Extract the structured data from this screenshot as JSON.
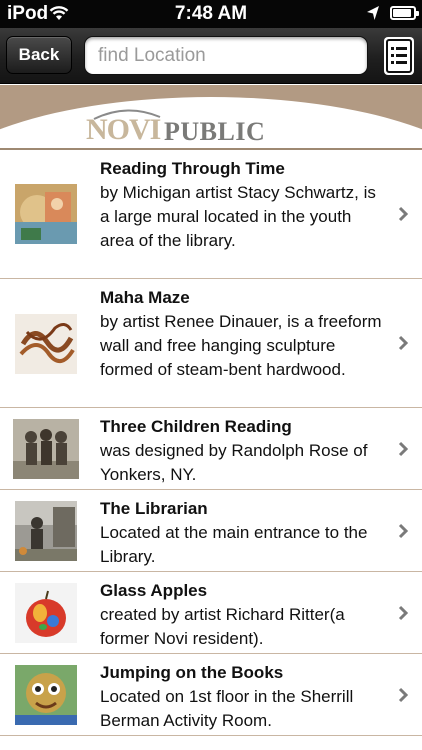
{
  "status_bar": {
    "carrier": "iPod",
    "time": "7:48 AM",
    "battery_level": 0.9
  },
  "navbar": {
    "back_label": "Back",
    "search_placeholder": "find Location",
    "list_icon": "list-icon"
  },
  "banner": {
    "logo_novi": "NOVI",
    "logo_library": "PUBLIC LIBRARY"
  },
  "items": [
    {
      "title": "Reading Through Time",
      "desc": "by Michigan artist Stacy Schwartz, is a large mural located in the youth area of the library."
    },
    {
      "title": "Maha Maze",
      "desc": "by artist Renee Dinauer, is a freeform wall and free hanging sculpture formed of steam-bent hardwood."
    },
    {
      "title": "Three Children Reading",
      "desc": "was designed by Randolph Rose of Yonkers, NY."
    },
    {
      "title": "The Librarian",
      "desc": "Located at the main entrance to the Library."
    },
    {
      "title": "Glass Apples",
      "desc": "created by artist Richard Ritter(a former Novi resident)."
    },
    {
      "title": "Jumping on the Books",
      "desc": "Located on 1st floor in the Sherrill Berman Activity Room."
    }
  ],
  "colors": {
    "banner_tan": "#b29a83",
    "divider": "#c9b6a3",
    "navbar_dark": "#1f1f1f"
  }
}
